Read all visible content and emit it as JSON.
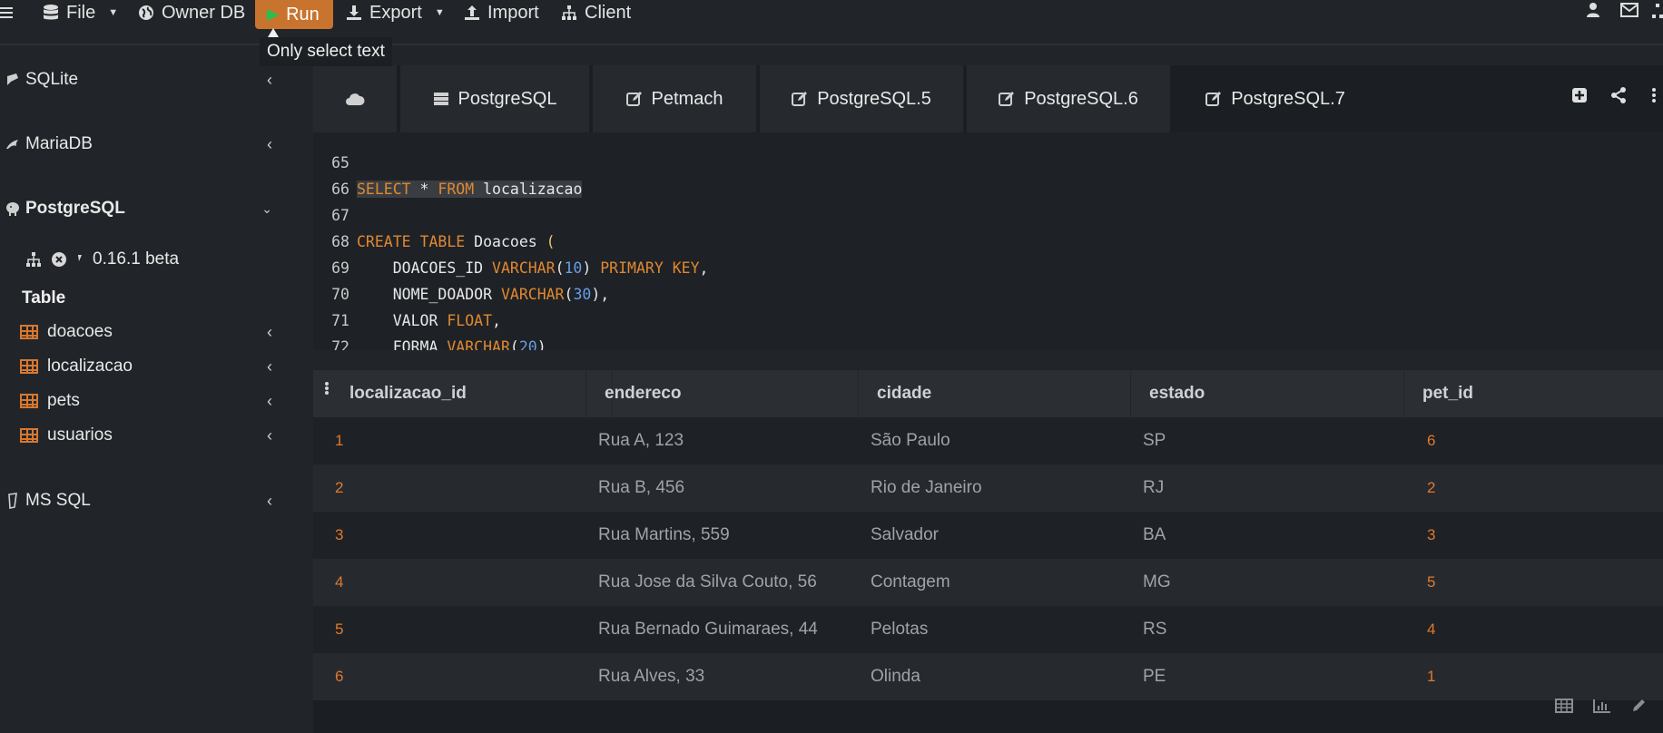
{
  "topbar": {
    "menu_icon": "hamburger-icon",
    "file_label": "File",
    "ownerdb_label": "Owner DB",
    "run_label": "Run",
    "export_label": "Export",
    "import_label": "Import",
    "client_label": "Client",
    "run_color": "#c8742f"
  },
  "tooltip": {
    "text": "Only select text"
  },
  "sidebar": {
    "groups": [
      {
        "label": "SQLite",
        "icon": "feather-icon"
      },
      {
        "label": "MariaDB",
        "icon": "dolphin-icon"
      },
      {
        "label": "PostgreSQL",
        "icon": "elephant-icon"
      },
      {
        "label": "MS SQL",
        "icon": "server-icon"
      }
    ],
    "pg_version": "0.16.1 beta",
    "table_heading": "Table",
    "tables": [
      "doacoes",
      "localizacao",
      "pets",
      "usuarios"
    ]
  },
  "tabs": [
    {
      "label": "",
      "icon": "cloud-icon"
    },
    {
      "label": "PostgreSQL",
      "icon": "server-icon"
    },
    {
      "label": "Petmach",
      "icon": "edit-icon"
    },
    {
      "label": "PostgreSQL.5",
      "icon": "edit-icon"
    },
    {
      "label": "PostgreSQL.6",
      "icon": "edit-icon"
    },
    {
      "label": "PostgreSQL.7",
      "icon": "edit-icon"
    }
  ],
  "editor": {
    "line_numbers": [
      "65",
      "66",
      "67",
      "68",
      "69",
      "70",
      "71",
      "72"
    ],
    "lines": {
      "l66_kw1": "SELECT",
      "l66_mid": " * ",
      "l66_kw2": "FROM",
      "l66_tail": " localizacao",
      "l68_kw": "CREATE TABLE",
      "l68_tail": " Doacoes ",
      "l68_paren": "(",
      "l69_name": "    DOACOES_ID ",
      "l69_type": "VARCHAR",
      "l69_num": "10",
      "l69_kw": "PRIMARY KEY",
      "l70_name": "    NOME_DOADOR ",
      "l70_type": "VARCHAR",
      "l70_num": "30",
      "l71_name": "    VALOR ",
      "l71_type": "FLOAT",
      "l72_name": "    FORMA ",
      "l72_type": "VARCHAR",
      "l72_num": "20"
    }
  },
  "grid": {
    "columns": [
      "localizacao_id",
      "endereco",
      "cidade",
      "estado",
      "pet_id"
    ],
    "rows": [
      [
        "1",
        "Rua A, 123",
        "São Paulo",
        "SP",
        "6"
      ],
      [
        "2",
        "Rua B, 456",
        "Rio de Janeiro",
        "RJ",
        "2"
      ],
      [
        "3",
        "Rua Martins, 559",
        "Salvador",
        "BA",
        "3"
      ],
      [
        "4",
        "Rua Jose da Silva Couto, 56",
        "Contagem",
        "MG",
        "5"
      ],
      [
        "5",
        "Rua Bernado Guimaraes, 44",
        "Pelotas",
        "RS",
        "4"
      ],
      [
        "6",
        "Rua Alves, 33",
        "Olinda",
        "PE",
        "1"
      ]
    ]
  }
}
